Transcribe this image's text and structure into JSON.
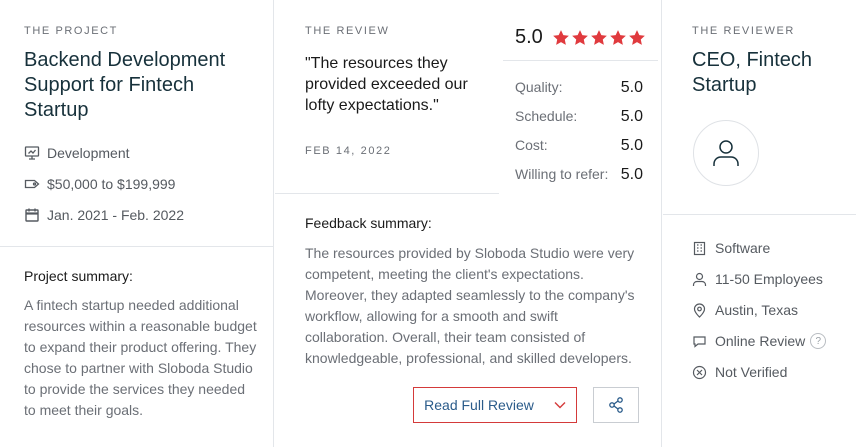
{
  "project": {
    "section_label": "THE PROJECT",
    "title": "Backend Development Support for Fintech Startup",
    "meta": [
      {
        "icon": "monitor-chart-icon",
        "text": "Development"
      },
      {
        "icon": "price-tag-icon",
        "text": "$50,000 to $199,999"
      },
      {
        "icon": "calendar-icon",
        "text": "Jan. 2021 - Feb. 2022"
      }
    ],
    "summary_heading": "Project summary:",
    "summary_text": "A fintech startup needed additional resources within a reasonable budget to expand their product offering. They chose to partner with Sloboda Studio to provide the services they needed to meet their goals."
  },
  "review": {
    "section_label": "THE REVIEW",
    "quote": "\"The resources they provided exceeded our lofty expectations.\"",
    "date": "FEB 14, 2022",
    "overall_score": "5.0",
    "stars": 5,
    "star_color": "#e03a3e",
    "ratings": [
      {
        "label": "Quality:",
        "value": "5.0"
      },
      {
        "label": "Schedule:",
        "value": "5.0"
      },
      {
        "label": "Cost:",
        "value": "5.0"
      },
      {
        "label": "Willing to refer:",
        "value": "5.0"
      }
    ],
    "feedback_heading": "Feedback summary:",
    "feedback_text": "The resources provided by Sloboda Studio were very competent, meeting the client's expectations. Moreover, they adapted seamlessly to the company's workflow, allowing for a smooth and swift collaboration. Overall, their team consisted of knowledgeable, professional, and skilled developers.",
    "read_button_label": "Read Full Review",
    "accent_border_color": "#d43a3a",
    "link_color": "#2a5b8a"
  },
  "reviewer": {
    "section_label": "THE REVIEWER",
    "title": "CEO, Fintech Startup",
    "info": [
      {
        "icon": "building-icon",
        "text": "Software"
      },
      {
        "icon": "person-icon",
        "text": "11-50 Employees"
      },
      {
        "icon": "location-pin-icon",
        "text": "Austin, Texas"
      },
      {
        "icon": "chat-bubble-icon",
        "text": "Online Review",
        "help": "?"
      },
      {
        "icon": "x-circle-icon",
        "text": "Not Verified"
      }
    ]
  }
}
